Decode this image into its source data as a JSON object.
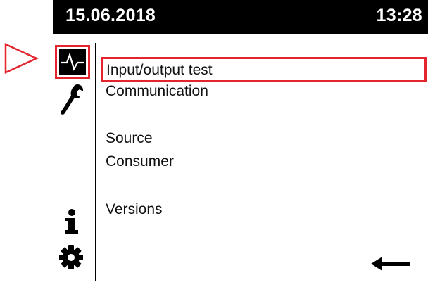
{
  "header": {
    "date": "15.06.2018",
    "time": "13:28"
  },
  "sidebar": {
    "icons": [
      {
        "name": "activity-icon",
        "selected": true
      },
      {
        "name": "wrench-icon",
        "selected": false
      },
      {
        "name": "info-icon",
        "selected": false
      },
      {
        "name": "gear-icon",
        "selected": false
      }
    ]
  },
  "menu": {
    "items": [
      {
        "label": "Input/output test",
        "selected": true
      },
      {
        "label": "Communication",
        "selected": false
      },
      {
        "label": "Source",
        "selected": false
      },
      {
        "label": "Consumer",
        "selected": false
      },
      {
        "label": "Versions",
        "selected": false
      }
    ]
  },
  "footer": {
    "back_icon": "arrow-left-icon"
  },
  "colors": {
    "accent": "#e2252f",
    "header_bg": "#000000",
    "header_text": "#ffffff"
  },
  "annotation": {
    "pointer_icon": "pointer-triangle-icon"
  }
}
